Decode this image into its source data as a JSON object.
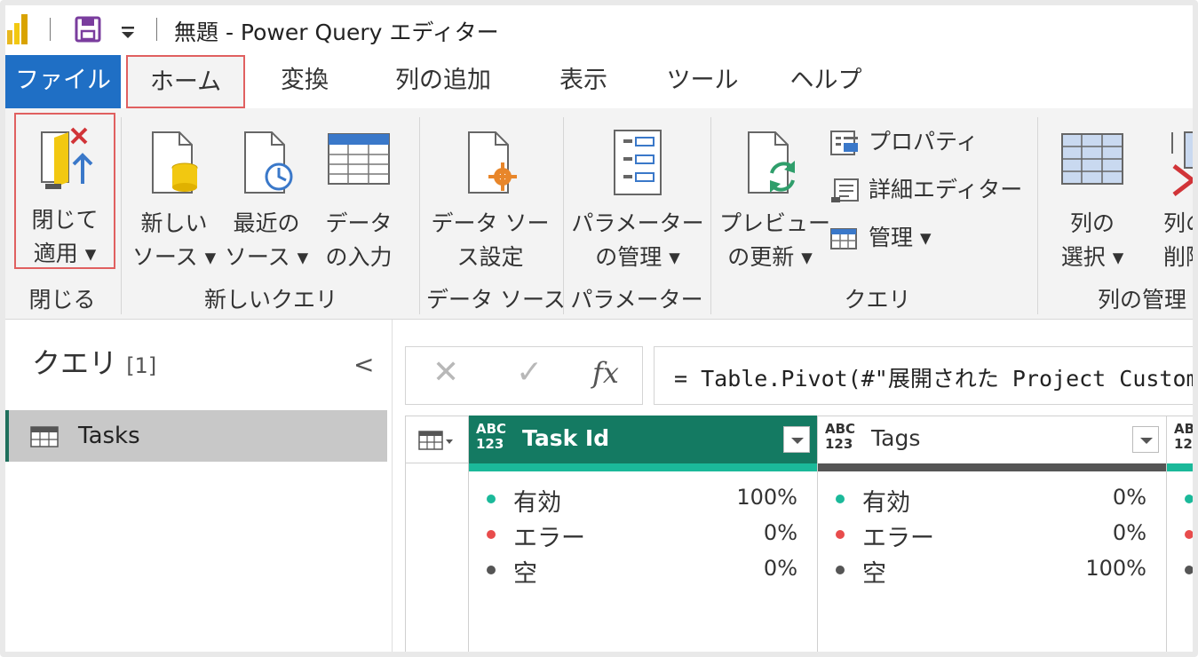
{
  "window": {
    "title": "無題 - Power Query エディター"
  },
  "tabs": [
    {
      "label": "ファイル"
    },
    {
      "label": "ホーム"
    },
    {
      "label": "変換"
    },
    {
      "label": "列の追加"
    },
    {
      "label": "表示"
    },
    {
      "label": "ツール"
    },
    {
      "label": "ヘルプ"
    }
  ],
  "ribbon": {
    "close_apply": "閉じて\n適用 ▾",
    "new_source": "新しい\nソース ▾",
    "recent_source": "最近の\nソース ▾",
    "enter_data": "データ\nの入力",
    "data_source_settings": "データ ソー\nス設定",
    "manage_parameters": "パラメーター\nの管理 ▾",
    "refresh_preview": "プレビュー\nの更新 ▾",
    "properties": "プロパティ",
    "advanced_editor": "詳細エディター",
    "manage": "管理 ▾",
    "choose_columns": "列の\n選択 ▾",
    "remove_columns": "列の\n削除",
    "groups": {
      "close": "閉じる",
      "new_query": "新しいクエリ",
      "data_sources": "データ ソース",
      "parameters": "パラメーター",
      "query": "クエリ",
      "manage_columns": "列の管理"
    }
  },
  "queries": {
    "title": "クエリ",
    "count": "[1]",
    "collapse": "<",
    "items": [
      {
        "label": "Tasks"
      }
    ]
  },
  "formula": {
    "cancel": "✕",
    "commit": "✓",
    "fx": "fx",
    "text": "= Table.Pivot(#\"展開された Project Custom Fields\""
  },
  "grid": {
    "type_label": "ABC\n123",
    "columns": [
      {
        "name": "Task Id",
        "stats": [
          {
            "name": "有効",
            "pct": "100%"
          },
          {
            "name": "エラー",
            "pct": "0%"
          },
          {
            "name": "空",
            "pct": "0%"
          }
        ]
      },
      {
        "name": "Tags",
        "stats": [
          {
            "name": "有効",
            "pct": "0%"
          },
          {
            "name": "エラー",
            "pct": "0%"
          },
          {
            "name": "空",
            "pct": "100%"
          }
        ]
      }
    ]
  },
  "colors": {
    "accent_blue": "#1f6fc5",
    "selected_column": "#147a62",
    "valid": "#1bb99a",
    "error": "#e84c4c",
    "empty": "#555555",
    "highlight_box": "#e06060"
  }
}
